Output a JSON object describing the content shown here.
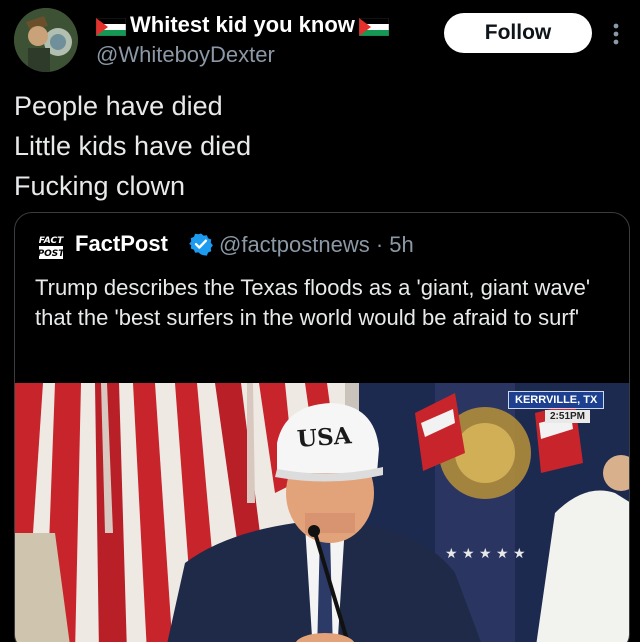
{
  "author": {
    "display_name": "Whitest kid you know",
    "handle": "@WhiteboyDexter",
    "follow_label": "Follow"
  },
  "tweet": {
    "lines": [
      "People have died",
      "Little kids have died",
      "Fucking clown"
    ]
  },
  "quoted_post": {
    "name": "FactPost",
    "handle_time": "@factpostnews · 5h",
    "logo_text": "FACT POST",
    "text": "Trump describes the Texas floods as a 'giant, giant wave' that the 'best surfers in the world would be afraid to surf'",
    "media": {
      "chyron_location": "KERRVILLE, TX",
      "chyron_time": "2:51PM",
      "cap_text": "USA"
    }
  },
  "icons": {
    "flag": "palestine-flag-icon",
    "more": "more-vertical-icon",
    "verified": "verified-badge-icon"
  },
  "colors": {
    "background": "#000000",
    "verified_blue": "#1d9bf0",
    "secondary_text": "#8b98a5"
  }
}
